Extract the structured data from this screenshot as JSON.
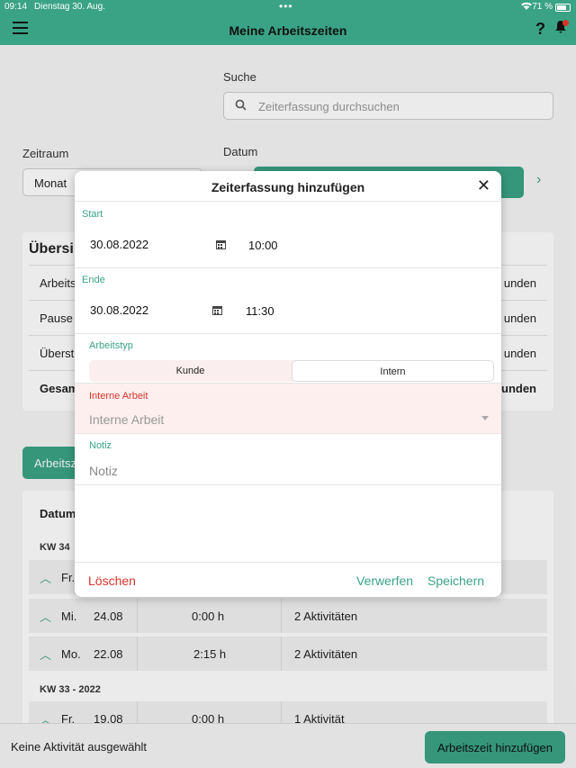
{
  "status_bar": {
    "time": "09:14",
    "date": "Dienstag 30. Aug.",
    "battery": "71 %"
  },
  "nav": {
    "title": "Meine Arbeitszeiten"
  },
  "search": {
    "label": "Suche",
    "placeholder": "Zeiterfassung durchsuchen"
  },
  "filters": {
    "zeitraum_label": "Zeitraum",
    "zeitraum_value": "Monat",
    "datum_label": "Datum"
  },
  "overview": {
    "title": "Übersi",
    "rows": [
      {
        "label": "Arbeits",
        "value": "unden"
      },
      {
        "label": "Pause",
        "value": "unden"
      },
      {
        "label": "Überst",
        "value": "unden"
      },
      {
        "label": "Gesam",
        "value": "unden"
      }
    ]
  },
  "tab": {
    "label": "Arbeitsze"
  },
  "list": {
    "header": "Datum",
    "weeks": [
      {
        "label": "KW 34",
        "rows": [
          {
            "day": "Fr.",
            "date": "",
            "hours": "",
            "activities": ""
          },
          {
            "day": "Mi.",
            "date": "24.08",
            "hours": "0:00 h",
            "activities": "2 Aktivitäten"
          },
          {
            "day": "Mo.",
            "date": "22.08",
            "hours": "2:15 h",
            "activities": "2 Aktivitäten"
          }
        ]
      },
      {
        "label": "KW 33 - 2022",
        "rows": [
          {
            "day": "Fr.",
            "date": "19.08",
            "hours": "0:00 h",
            "activities": "1 Aktivität"
          }
        ]
      }
    ]
  },
  "bottom": {
    "no_activity": "Keine Aktivität ausgewählt",
    "add_button": "Arbeitszeit hinzufügen"
  },
  "modal": {
    "title": "Zeiterfassung hinzufügen",
    "start": {
      "label": "Start",
      "date": "30.08.2022",
      "time": "10:00"
    },
    "end": {
      "label": "Ende",
      "date": "30.08.2022",
      "time": "11:30"
    },
    "work_type": {
      "label": "Arbeitstyp",
      "options": [
        "Kunde",
        "Intern"
      ],
      "selected": "Intern"
    },
    "internal_work": {
      "label": "Interne Arbeit",
      "placeholder": "Interne Arbeit"
    },
    "note": {
      "label": "Notiz",
      "placeholder": "Notiz"
    },
    "footer": {
      "delete": "Löschen",
      "discard": "Verwerfen",
      "save": "Speichern"
    }
  },
  "colors": {
    "accent": "#3aa385",
    "danger": "#d9342b"
  },
  "icons": [
    "menu-icon",
    "help-icon",
    "bell-icon",
    "search-icon",
    "chevron-right-icon",
    "calendar-icon",
    "close-icon",
    "chevron-up-icon",
    "caret-down-icon"
  ]
}
